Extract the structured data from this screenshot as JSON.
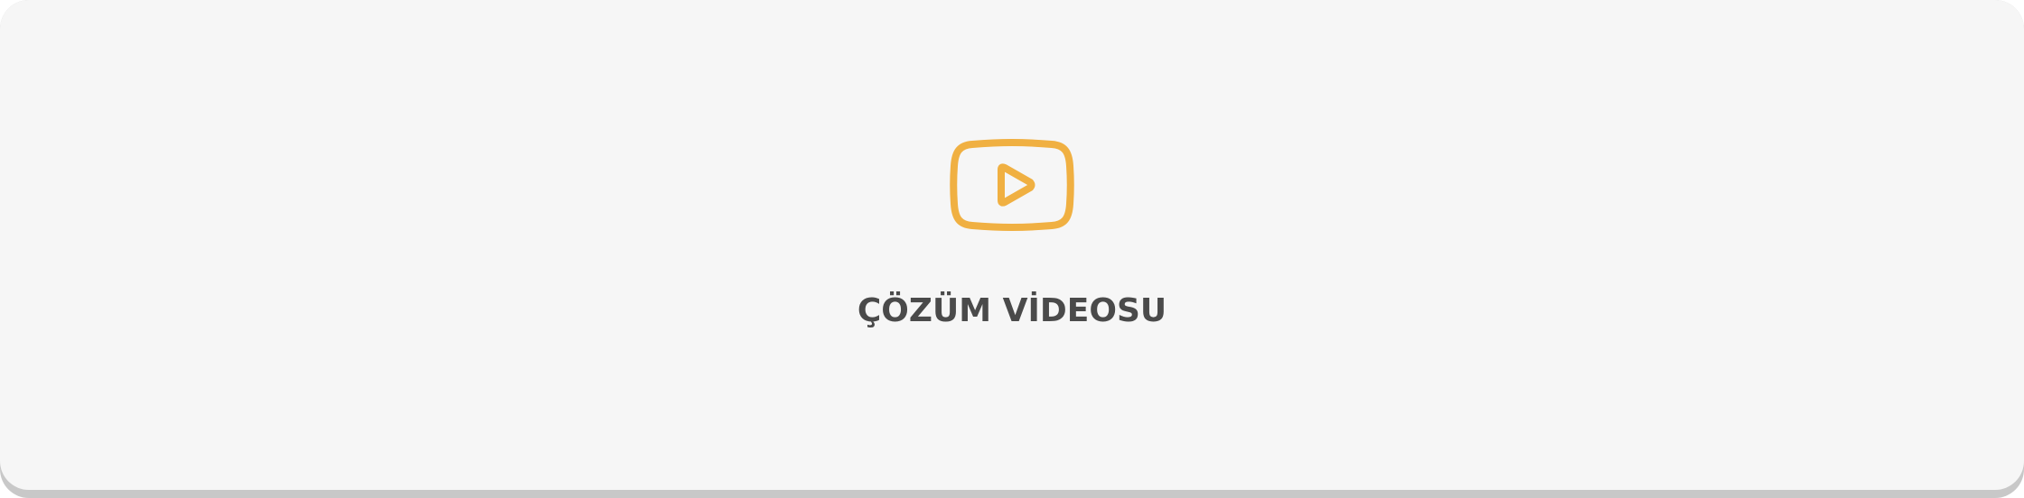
{
  "card": {
    "label": "ÇÖZÜM VİDEOSU",
    "icon": "video-play-icon"
  },
  "colors": {
    "card_background": "#f6f6f6",
    "card_shadow": "#c8c8c8",
    "icon_accent": "#f0b042",
    "label_text": "#4a4a4a"
  }
}
